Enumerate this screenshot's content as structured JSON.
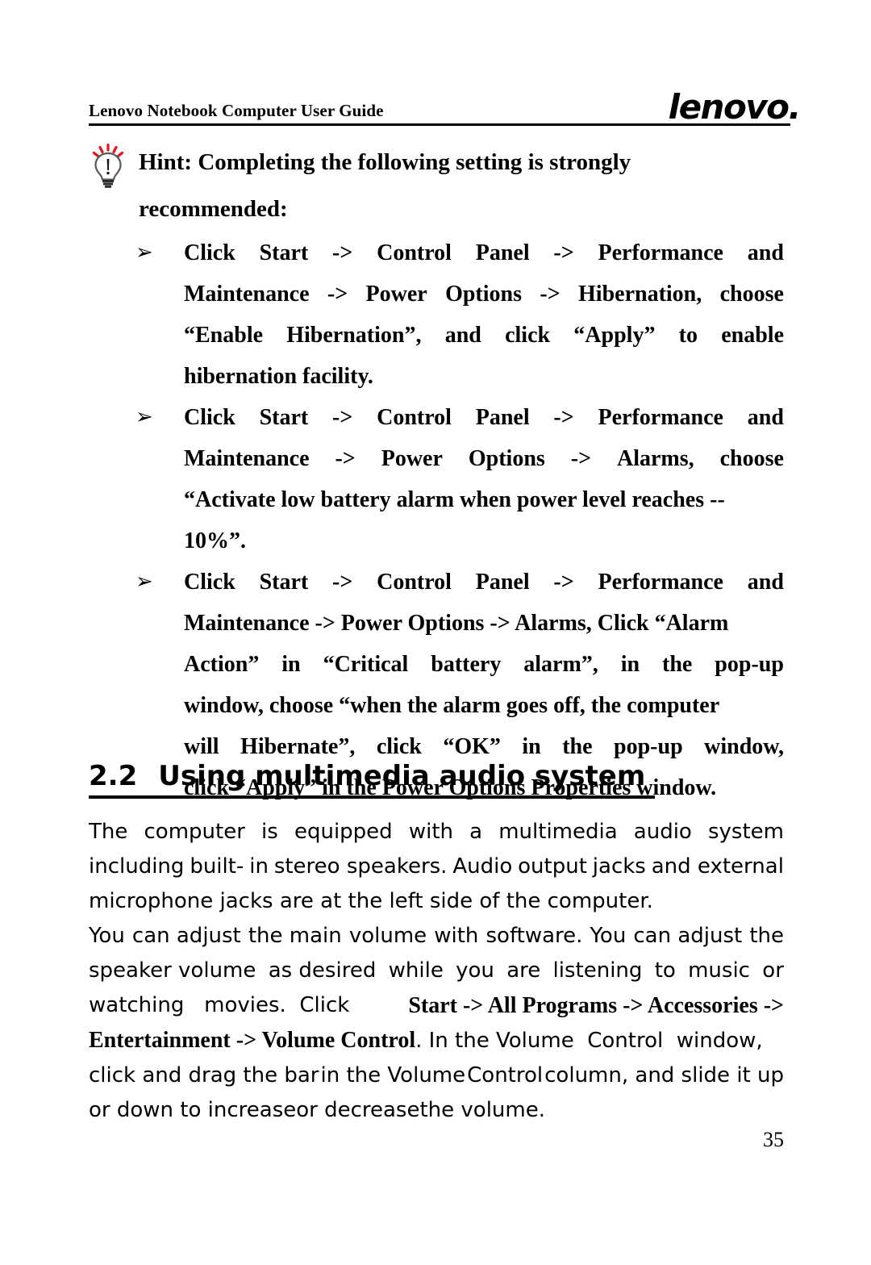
{
  "header": {
    "title": "Lenovo Notebook Computer User Guide",
    "logo": "lenovo."
  },
  "hint": {
    "icon_name": "lightbulb-hint-icon",
    "ray_color": "#e8121b",
    "bulb_color": "#58585a",
    "line1_words": [
      "Hint:",
      "Completing",
      "the",
      "following",
      "setting",
      "is",
      "strongly"
    ],
    "line2": "recommended:",
    "full_text": "Hint: Completing the following setting is strongly recommended:"
  },
  "bullets": {
    "marker": "➢",
    "items": [
      {
        "full_text": "Click Start -> Control Panel -> Performance and Maintenance -> Power Options -> Hibernation, choose “Enable Hibernation”, and click “Apply” to enable hibernation facility.",
        "lines": [
          [
            "Click",
            "Start",
            "->",
            "Control",
            "Panel",
            "->",
            "Performance",
            "and"
          ],
          [
            "Maintenance",
            "->",
            "Power",
            "Options",
            "->",
            "Hibernation,",
            "choose"
          ],
          [
            "“Enable",
            "Hibernation”,",
            "and",
            "click",
            "“Apply”",
            "to",
            "enable"
          ],
          [
            "hibernation facility."
          ]
        ]
      },
      {
        "full_text": "Click Start -> Control Panel -> Performance and Maintenance -> Power Options -> Alarms, choose “Activate low battery alarm when power level reaches -- 10%”.",
        "lines": [
          [
            "Click",
            "Start",
            "->",
            "Control",
            "Panel",
            "->",
            "Performance",
            "and"
          ],
          [
            "Maintenance",
            "->",
            "Power",
            "Options",
            "->",
            "Alarms,",
            "choose"
          ],
          [
            "“Activate low battery alarm when power level reaches --"
          ],
          [
            "10%”."
          ]
        ]
      },
      {
        "full_text": "Click Start -> Control Panel -> Performance and Maintenance -> Power Options -> Alarms, Click “Alarm Action” in “Critical battery alarm”, in the pop-up window, choose “when the alarm goes off, the computer will Hibernate”, click “OK” in the pop-up window, click “Apply” in the Power Options Properties window.",
        "lines": [
          [
            "Click",
            "Start",
            "->",
            "Control",
            "Panel",
            "->",
            "Performance",
            "and"
          ],
          [
            "Maintenance -> Power Options -> Alarms, Click “Alarm"
          ],
          [
            "Action”",
            "in",
            "“Critical",
            "battery",
            "alarm”,",
            "in",
            "the",
            "pop-up"
          ],
          [
            "window, choose “when the alarm goes off, the computer"
          ],
          [
            "will",
            "Hibernate”,",
            "click",
            "“OK”",
            "in",
            "the",
            "pop-up",
            "window,"
          ],
          [
            "click “Apply” in the Power Options Properties window."
          ]
        ]
      }
    ]
  },
  "section": {
    "number": "2.2",
    "title": "Using multimedia audio system"
  },
  "body": {
    "paragraph1": {
      "full_text": "The computer is equipped with a multimedia audio system including built- in stereo speakers. Audio output jacks and external microphone jacks are at the left side of the computer.",
      "lines": [
        [
          "The",
          "computer",
          "is",
          "equipped",
          "with",
          "a",
          "multimedia",
          "audio",
          "system"
        ],
        [
          "including",
          "built-",
          "in",
          "stereo speakers.",
          "Audio",
          "output",
          "jacks",
          "and external"
        ],
        [
          "microphone jacks are at the left side of the computer."
        ]
      ]
    },
    "paragraph2": {
      "full_text": "You can adjust the main volume with software. You can adjust the speaker volume as desired while you are listening to music or watching movies. Click Start -> All Programs -> Accessories -> Entertainment -> Volume Control. In the Volume Control window, click and drag the bar in the Volume Control column, and slide it up or down to increase or decrease the volume.",
      "line1": [
        "You",
        "can adjust",
        "the main",
        "volume",
        "with",
        "software.",
        "You",
        "can adjust",
        "the"
      ],
      "line2": [
        "speaker volume",
        "as desired",
        "while",
        "you",
        "are",
        "listening",
        "to",
        "music",
        "or"
      ],
      "line3_plain": "watching   movies.  Click ",
      "line3_bold": "Start -> All Programs -> Accessories ->",
      "line4_bold": "Entertainment -> Volume Control",
      "line4_plain": ". In the Volume  Control  window,",
      "line5": [
        "click and drag the bar",
        "in the Volume",
        "Control",
        "column, and slide it up"
      ],
      "line6": "or down  to increaseor decreasethe volume."
    }
  },
  "footer": {
    "page_number": "35"
  }
}
